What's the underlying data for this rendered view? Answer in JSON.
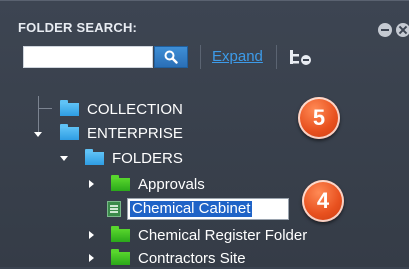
{
  "panel": {
    "title": "FOLDER SEARCH:",
    "search": {
      "value": "",
      "placeholder": ""
    },
    "expand_label": "Expand"
  },
  "tree": {
    "items": [
      {
        "label": "COLLECTION",
        "icon": "folder-blue-icon"
      },
      {
        "label": "ENTERPRISE",
        "icon": "folder-blue-icon",
        "expanded": true
      },
      {
        "label": "FOLDERS",
        "icon": "folder-blue-icon",
        "expanded": true
      },
      {
        "label": "Approvals",
        "icon": "folder-green-icon"
      },
      {
        "label": "Chemical Cabinet",
        "icon": "file-icon",
        "editing": true
      },
      {
        "label": "Chemical Register Folder",
        "icon": "folder-green-icon"
      },
      {
        "label": "Contractors Site",
        "icon": "folder-green-icon"
      }
    ]
  },
  "callouts": [
    {
      "number": "5"
    },
    {
      "number": "4"
    }
  ],
  "colors": {
    "panel_bg": "#3b4350",
    "accent_blue": "#2a6fb6",
    "link": "#3d9be9",
    "folder_blue": "#2e9de3",
    "folder_green": "#2aa81a",
    "selection": "#1f63c7",
    "callout": "#e8511f"
  }
}
